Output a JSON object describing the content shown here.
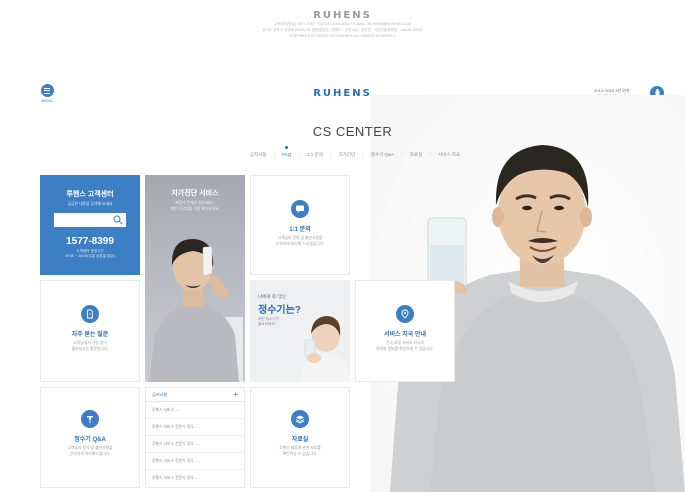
{
  "footer": {
    "logo": "RUHENS",
    "lines": [
      "고객센터(평일) 1577-7730 · FAX 031-8048-6060 · E-MAIL : RUHENS@RUHENS.COM",
      "경기도 군포시 공단로 (5005) 3F 청운빌딩(주) 루헨스 · 대표이사 : 권영진 · 사업자등록번호 : 138-86-00022",
      "COPYRIGHT(C) SINCE 2013 RUHENS ALL RIGHTS RESERVED"
    ]
  },
  "header": {
    "menu_label": "MENU",
    "logo": "RUHENS",
    "award_line1": "2014~2016 3년 연속",
    "award_line2": "고객사랑 브랜드 대상"
  },
  "page_title": "CS CENTER",
  "tabs": [
    {
      "label": "공지사항"
    },
    {
      "label": "FAQ",
      "active": true
    },
    {
      "label": "1:1 문의"
    },
    {
      "label": "자가진단"
    },
    {
      "label": "정수기 Q&A"
    },
    {
      "label": "자료실"
    },
    {
      "label": "서비스 지국"
    }
  ],
  "cs_center": {
    "title": "루헨스 고객센터",
    "subtitle": "궁금한 내용을 검색해 보세요",
    "phone": "1577-8399",
    "hours_line1": "고객센터 운영시간",
    "hours_line2": "09:00 ~ 18:00(주말 공휴일 휴무)"
  },
  "self_diag": {
    "title": "자가진단 서비스",
    "line1": "제품에 문제가 있으세요?",
    "line2": "쉬운 진단법을 직접 확인하세요."
  },
  "inquiry": {
    "title": "1:1 문의",
    "line1": "고객님의 문의 및 불만사항을",
    "line2": "신속하게 처리해 드리겠습니다."
  },
  "faq": {
    "title": "자주 묻는 질문",
    "line1": "고객님께서 가장 많이",
    "line2": "물어보시는 질문입니다."
  },
  "water_q": {
    "small": "나에게 꼭! 맞는",
    "big": "정수기는?",
    "line1": "어떤 정수기가",
    "line2": "필요하세요?"
  },
  "branch": {
    "title": "서비스 지국 안내",
    "line1": "전국 지점 서비스 지국의",
    "line2": "위치와 정보를 확인하실 수 있습니다."
  },
  "purifier_qa": {
    "title": "정수기 Q&A",
    "line1": "고객님의 문의 및 불만사항을",
    "line2": "신속하게 처리해드립니다."
  },
  "notice": {
    "title": "공지사항",
    "plus": "+",
    "rows": [
      "루헨스 서비스......",
      "루헨스 서비스 전문가 루다......",
      "루헨스 서비스 전문가 루다......",
      "루헨스 서비스 전문가 루다......",
      "루헨스 서비스 전문가 루다......"
    ]
  },
  "archive": {
    "title": "자료실",
    "line1": "루헨스 제품에 관한 자료를",
    "line2": "확인하실 수 있습니다."
  },
  "colors": {
    "brand_blue": "#3d7fc4",
    "title_blue": "#2b6db3"
  }
}
